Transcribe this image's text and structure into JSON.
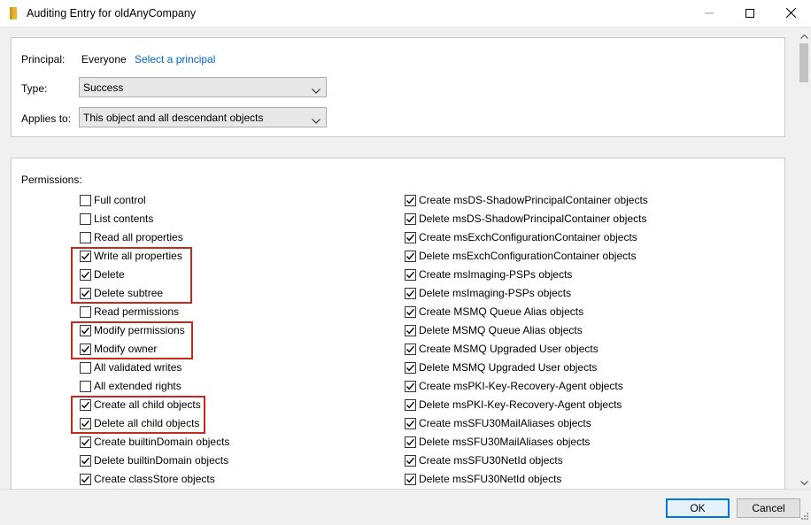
{
  "window": {
    "title": "Auditing Entry for oldAnyCompany"
  },
  "principal": {
    "label": "Principal:",
    "value": "Everyone",
    "link": "Select a principal"
  },
  "type": {
    "label": "Type:",
    "value": "Success"
  },
  "applies_to": {
    "label": "Applies to:",
    "value": "This object and all descendant objects"
  },
  "permissions": {
    "label": "Permissions:",
    "left": [
      {
        "label": "Full control",
        "checked": false
      },
      {
        "label": "List contents",
        "checked": false
      },
      {
        "label": "Read all properties",
        "checked": false
      },
      {
        "label": "Write all properties",
        "checked": true
      },
      {
        "label": "Delete",
        "checked": true
      },
      {
        "label": "Delete subtree",
        "checked": true
      },
      {
        "label": "Read permissions",
        "checked": false
      },
      {
        "label": "Modify permissions",
        "checked": true
      },
      {
        "label": "Modify owner",
        "checked": true
      },
      {
        "label": "All validated writes",
        "checked": false
      },
      {
        "label": "All extended rights",
        "checked": false
      },
      {
        "label": "Create all child objects",
        "checked": true
      },
      {
        "label": "Delete all child objects",
        "checked": true
      },
      {
        "label": "Create builtinDomain objects",
        "checked": true
      },
      {
        "label": "Delete builtinDomain objects",
        "checked": true
      },
      {
        "label": "Create classStore objects",
        "checked": true
      }
    ],
    "right": [
      {
        "label": "Create msDS-ShadowPrincipalContainer objects",
        "checked": true
      },
      {
        "label": "Delete msDS-ShadowPrincipalContainer objects",
        "checked": true
      },
      {
        "label": "Create msExchConfigurationContainer objects",
        "checked": true
      },
      {
        "label": "Delete msExchConfigurationContainer objects",
        "checked": true
      },
      {
        "label": "Create msImaging-PSPs objects",
        "checked": true
      },
      {
        "label": "Delete msImaging-PSPs objects",
        "checked": true
      },
      {
        "label": "Create MSMQ Queue Alias objects",
        "checked": true
      },
      {
        "label": "Delete MSMQ Queue Alias objects",
        "checked": true
      },
      {
        "label": "Create MSMQ Upgraded User objects",
        "checked": true
      },
      {
        "label": "Delete MSMQ Upgraded User objects",
        "checked": true
      },
      {
        "label": "Create msPKI-Key-Recovery-Agent objects",
        "checked": true
      },
      {
        "label": "Delete msPKI-Key-Recovery-Agent objects",
        "checked": true
      },
      {
        "label": "Create msSFU30MailAliases objects",
        "checked": true
      },
      {
        "label": "Delete msSFU30MailAliases objects",
        "checked": true
      },
      {
        "label": "Create msSFU30NetId objects",
        "checked": true
      },
      {
        "label": "Delete msSFU30NetId objects",
        "checked": true
      }
    ]
  },
  "buttons": {
    "ok": "OK",
    "cancel": "Cancel"
  },
  "colors": {
    "highlight": "#c42b1c",
    "link": "#0066cc",
    "default_button_border": "#0078d7"
  }
}
